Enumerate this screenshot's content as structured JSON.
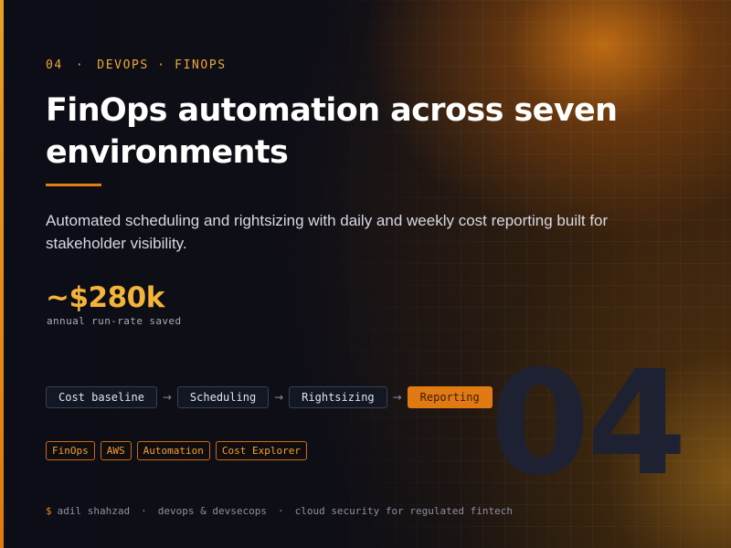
{
  "eyebrow": {
    "number": "04",
    "separator": "·",
    "category": "DEVOPS · FINOPS"
  },
  "title": "FinOps automation across seven environments",
  "subtitle": "Automated scheduling and rightsizing with daily and weekly cost reporting built for stakeholder visibility.",
  "metric": {
    "value": "~$280k",
    "label": "annual run-rate saved"
  },
  "pipeline": {
    "steps": [
      "Cost baseline",
      "Scheduling",
      "Rightsizing",
      "Reporting"
    ],
    "active_step": "Reporting",
    "arrow": "→"
  },
  "tags": [
    "FinOps",
    "AWS",
    "Automation",
    "Cost Explorer"
  ],
  "watermark": "04",
  "footer": {
    "prompt": "$",
    "name": "adil shahzad",
    "separator": "·",
    "role": "devops & devsecops",
    "tagline": "cloud security for regulated fintech"
  },
  "colors": {
    "accent": "#e37f12",
    "accent_text": "#f0a836",
    "metric": "#f4b43a",
    "background": "#0c0d16"
  }
}
